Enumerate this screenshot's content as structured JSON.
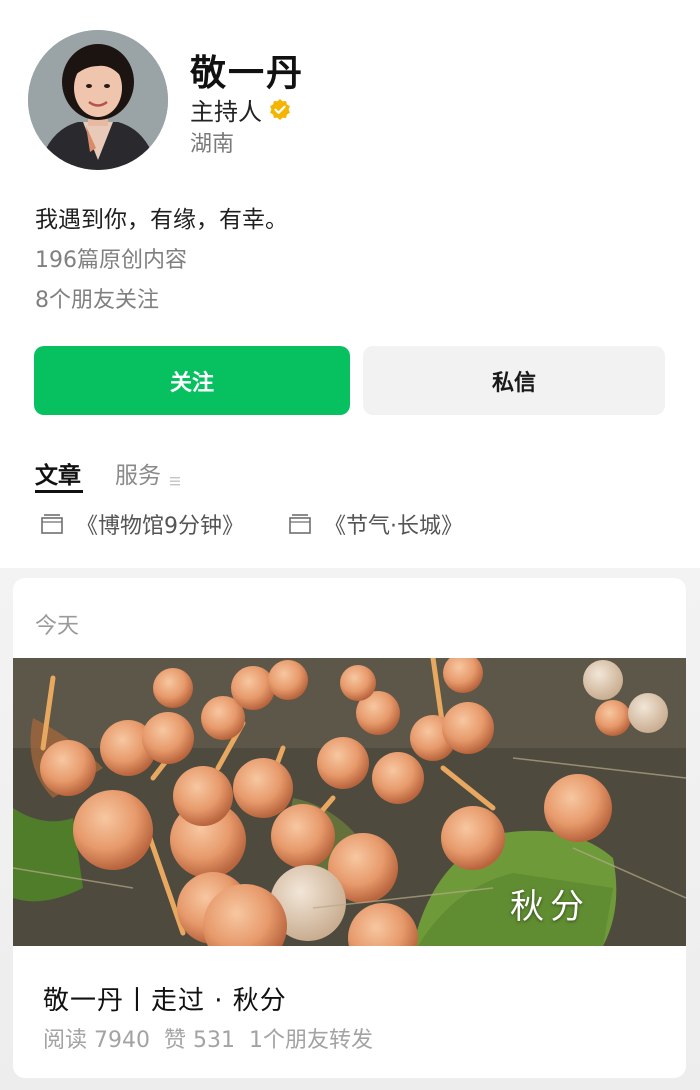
{
  "profile": {
    "name": "敬一丹",
    "title": "主持人",
    "region": "湖南",
    "motto": "我遇到你，有缘，有幸。",
    "original_count": "196篇原创内容",
    "friends_following": "8个朋友关注",
    "verified_icon": "verified-badge-icon",
    "verified_color": "#f5b400"
  },
  "actions": {
    "follow_label": "关注",
    "message_label": "私信",
    "follow_color": "#07c160"
  },
  "tabs": [
    {
      "label": "文章",
      "active": true
    },
    {
      "label": "服务",
      "active": false,
      "icon": "menu-icon"
    }
  ],
  "collections": [
    {
      "label": "《博物馆9分钟》",
      "icon": "folder-icon"
    },
    {
      "label": "《节气·长城》",
      "icon": "folder-icon"
    }
  ],
  "feed": {
    "date": "今天",
    "article": {
      "cover_caption": "秋分",
      "title": "敬一丹丨走过 · 秋分",
      "reads": "阅读 7940",
      "likes": "赞 531",
      "shares": "1个朋友转发"
    }
  }
}
